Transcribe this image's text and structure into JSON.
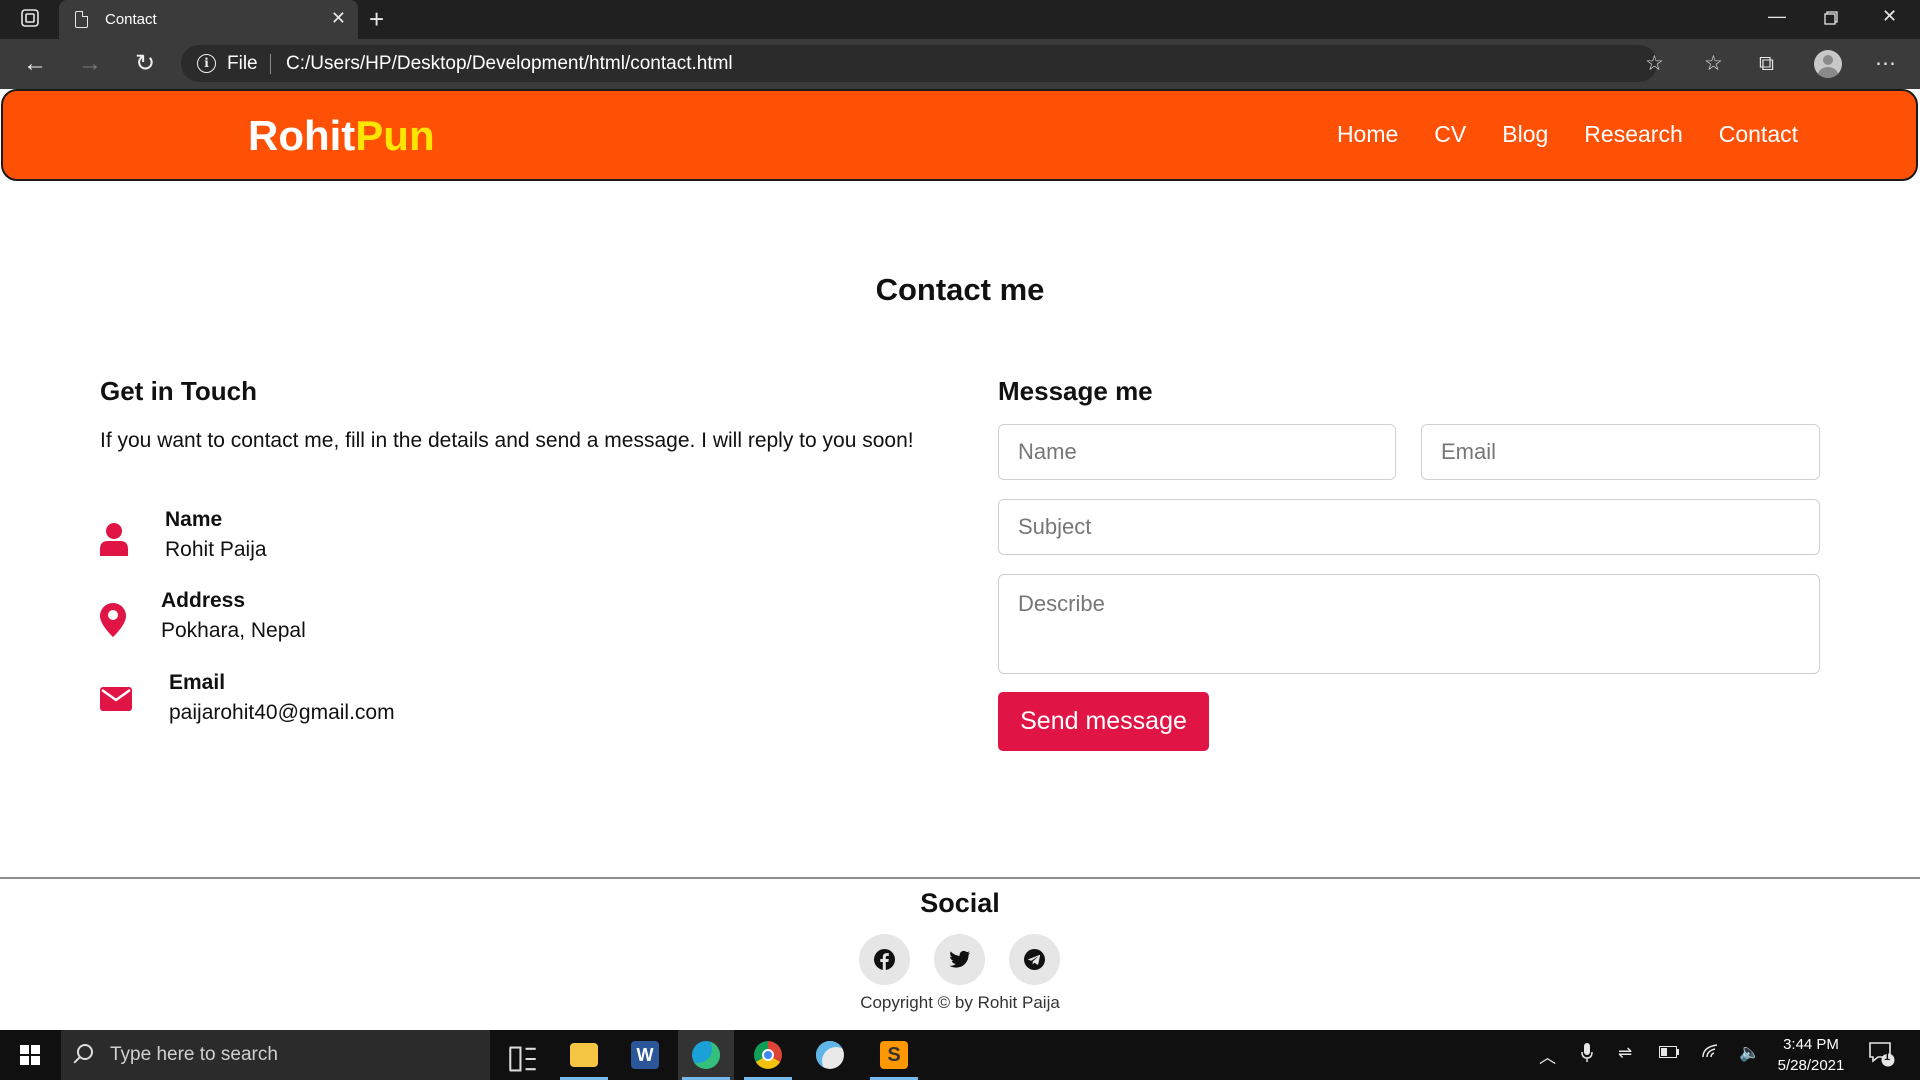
{
  "browser": {
    "tab_title": "Contact",
    "address_scheme": "File",
    "address_url": "C:/Users/HP/Desktop/Development/html/contact.html"
  },
  "site": {
    "brand_main": "Rohit",
    "brand_accent": "Pun",
    "nav": [
      "Home",
      "CV",
      "Blog",
      "Research",
      "Contact"
    ],
    "colors": {
      "header": "#ff5106",
      "brand_accent": "#ffe600",
      "accent": "#e01445"
    }
  },
  "main": {
    "title": "Contact me",
    "touch": {
      "heading": "Get in Touch",
      "lead": "If you want to contact me, fill in the details and send a message. I will reply to you soon!",
      "items": [
        {
          "icon": "user-icon",
          "label": "Name",
          "value": "Rohit Paija"
        },
        {
          "icon": "map-pin-icon",
          "label": "Address",
          "value": "Pokhara, Nepal"
        },
        {
          "icon": "envelope-icon",
          "label": "Email",
          "value": "paijarohit40@gmail.com"
        }
      ]
    },
    "form": {
      "heading": "Message me",
      "name_placeholder": "Name",
      "email_placeholder": "Email",
      "subject_placeholder": "Subject",
      "describe_placeholder": "Describe",
      "submit_label": "Send message"
    }
  },
  "footer": {
    "social_title": "Social",
    "social": [
      "facebook-icon",
      "twitter-icon",
      "telegram-icon"
    ],
    "copyright": "Copyright © by Rohit Paija"
  },
  "taskbar": {
    "search_placeholder": "Type here to search",
    "time": "3:44 PM",
    "date": "5/28/2021",
    "notification_count": "1"
  }
}
